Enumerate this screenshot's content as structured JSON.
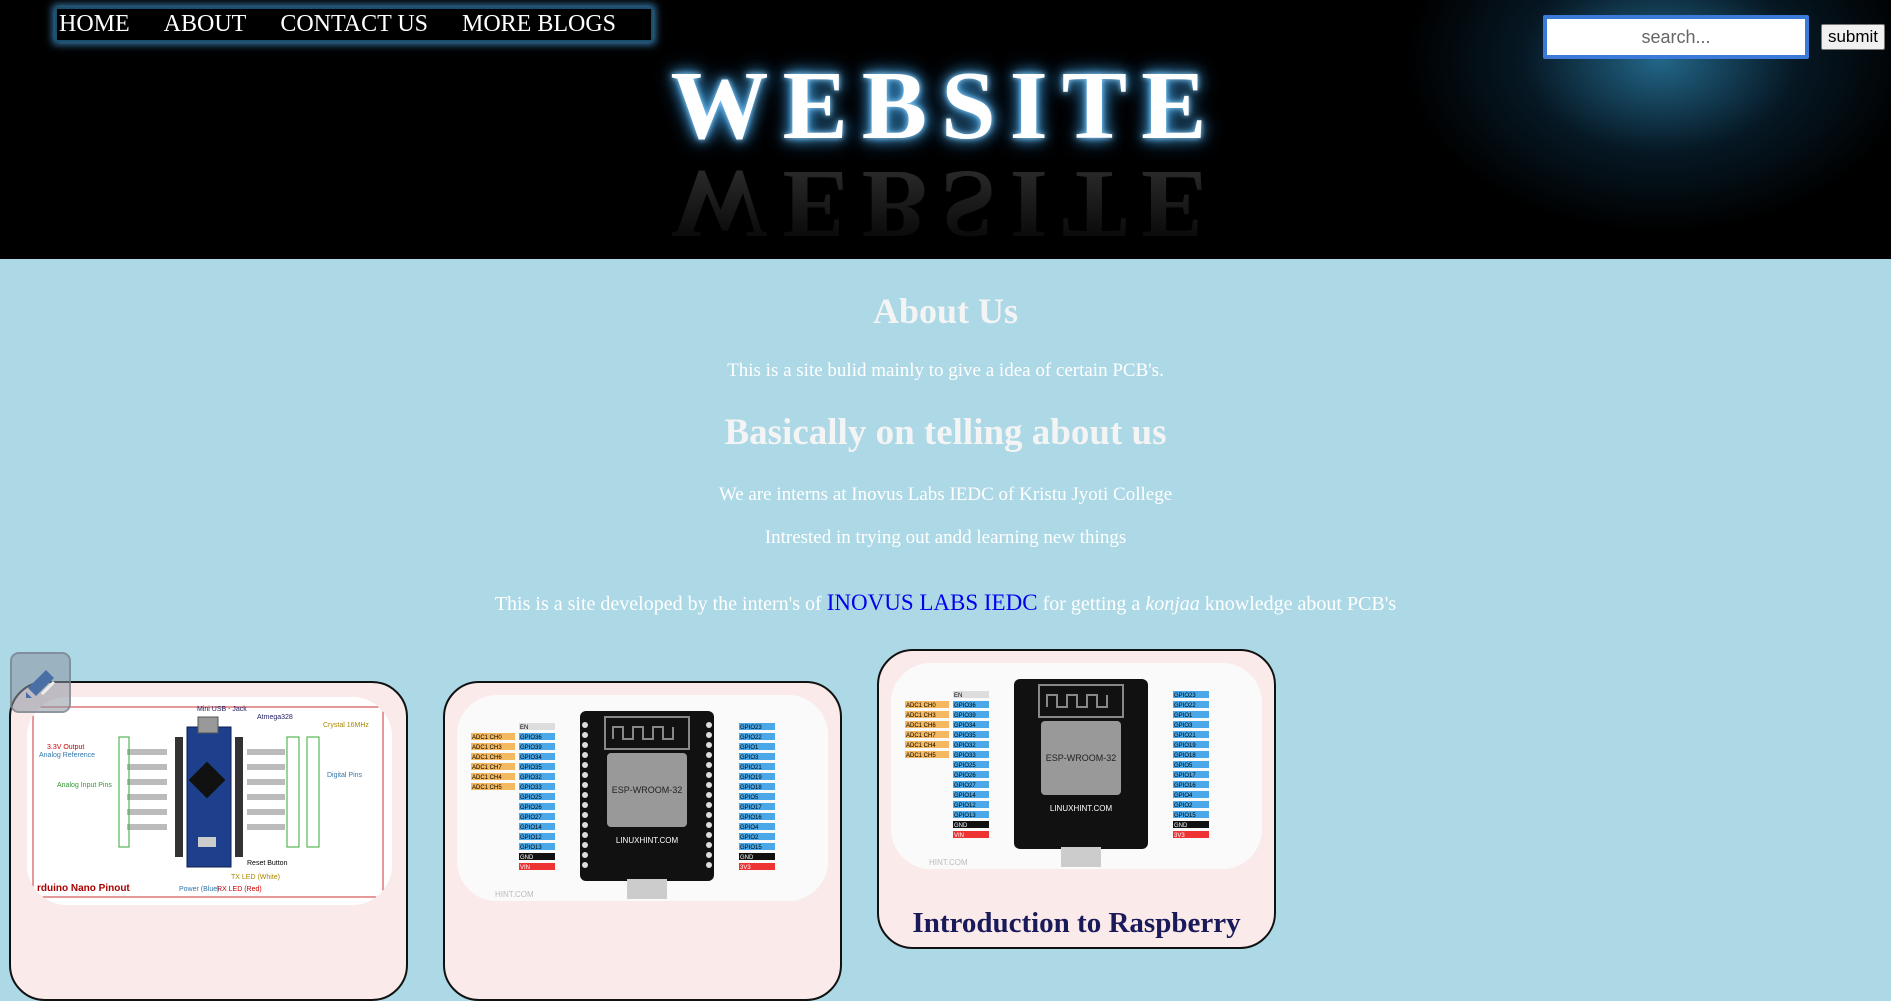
{
  "nav": {
    "items": [
      "HOME",
      "ABOUT",
      "CONTACT US",
      "MORE BLOGS"
    ]
  },
  "header": {
    "title": "WEBSITE"
  },
  "search": {
    "placeholder": "search...",
    "submit_label": "submit"
  },
  "about": {
    "title": "About Us",
    "line1": "This is a site bulid mainly to give a idea of certain PCB's.",
    "heading2": "Basically on telling about us",
    "line2": "We are interns at Inovus Labs IEDC of Kristu Jyoti College",
    "line3": "Intrested in trying out andd learning new things",
    "line4_pre": "This is a site developed by the intern's of ",
    "line4_link": "INOVUS LABS IEDC",
    "line4_mid": " for getting a ",
    "line4_em": "konjaa",
    "line4_post": " knowledge about PCB's"
  },
  "cards": [
    {
      "image_icon": "arduino-nano-pinout-image",
      "image_text": {
        "mini_usb": "Mini USB - Jack",
        "atmega": "Atmega328",
        "crystal": "Crystal 16MHz",
        "vout": "3.3V Output",
        "aref": "Analog Reference",
        "analog_in": "Analog Input Pins",
        "digital": "Digital Pins",
        "reset": "Reset Button",
        "caption": "rduino Nano Pinout",
        "power_led": "Power (Blue)",
        "rx_led": "RX LED (Red)",
        "tx_led": "TX LED (White)"
      }
    },
    {
      "image_icon": "esp32-pinout-image",
      "chip_label": "ESP-WROOM-32",
      "board_label": "LINUXHINT.COM",
      "watermark": "HINT.COM"
    },
    {
      "image_icon": "esp32-pinout-image",
      "chip_label": "ESP-WROOM-32",
      "board_label": "LINUXHINT.COM",
      "watermark": "HINT.COM",
      "title": "Introduction to Raspberry"
    }
  ],
  "esp32_pins": {
    "left_adc": [
      "ADC1 CH0",
      "ADC1 CH3",
      "ADC1 CH6",
      "ADC1 CH7",
      "ADC1 CH4",
      "ADC1 CH5"
    ],
    "left": [
      "EN",
      "GPIO36",
      "GPIO39",
      "GPIO34",
      "GPIO35",
      "GPIO32",
      "GPIO33",
      "GPIO25",
      "GPIO26",
      "GPIO27",
      "GPIO14",
      "GPIO12",
      "GPIO13",
      "GND",
      "VIN"
    ],
    "right": [
      "GPIO23",
      "GPIO22",
      "GPIO1",
      "GPIO3",
      "GPIO21",
      "GPIO19",
      "GPIO18",
      "GPIO5",
      "GPIO17",
      "GPIO16",
      "GPIO4",
      "GPIO2",
      "GPIO15",
      "GND",
      "3V3"
    ]
  },
  "colors": {
    "background": "#add8e6",
    "header_bg": "#000000",
    "link": "#0000ee",
    "card_bg": "#fbeaea",
    "search_border": "#3b7ad9"
  },
  "floating_button": {
    "icon": "pen-edit-icon"
  }
}
